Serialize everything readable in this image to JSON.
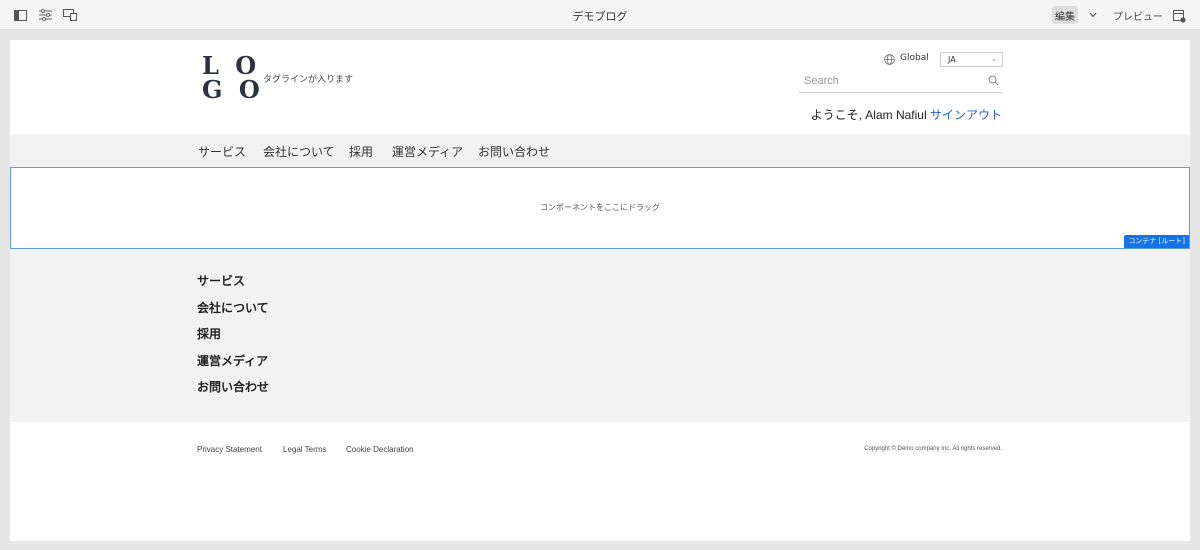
{
  "toolbar": {
    "title": "デモブログ",
    "edit_label": "編集",
    "preview_label": "プレビュー"
  },
  "header": {
    "logo_line1": "L O",
    "logo_line2": "G O",
    "tagline": "タグラインが入ります",
    "region_label": "Global",
    "language": "JA",
    "search_placeholder": "Search",
    "welcome_prefix": "ようこそ, Alam Nafiul ",
    "signout_label": "サインアウト"
  },
  "nav": {
    "items": [
      "サービス",
      "会社について",
      "採用",
      "運営メディア",
      "お問い合わせ"
    ]
  },
  "dropzone": {
    "text": "コンポーネントをここにドラッグ",
    "badge": "コンテナ [ルート]"
  },
  "footer_nav": {
    "items": [
      "サービス",
      "会社について",
      "採用",
      "運営メディア",
      "お問い合わせ"
    ]
  },
  "footer": {
    "links": [
      "Privacy Statement",
      "Legal Terms",
      "Cookie Declaration"
    ],
    "copyright": "Copyright © Demo company Inc. All rights reserved."
  },
  "colors": {
    "accent": "#1473e6",
    "link": "#2b62c4",
    "logo": "#2a3242"
  }
}
